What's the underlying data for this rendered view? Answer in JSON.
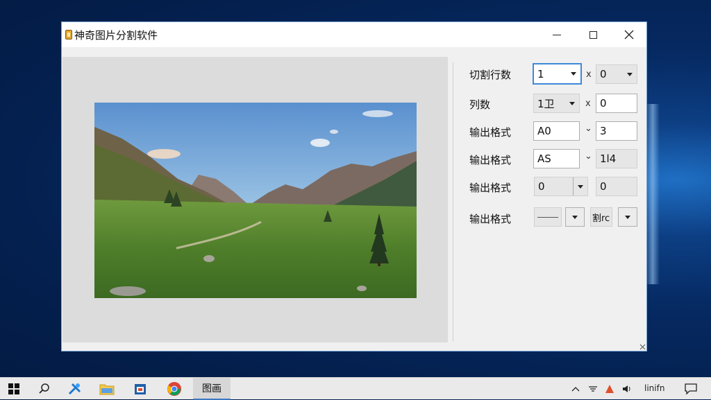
{
  "window": {
    "title": "神奇图片分割软件"
  },
  "form": {
    "rows_label": "切割行数",
    "rows_value": "1",
    "rows_sep": "x",
    "rows_value2": "0",
    "cols_label": "列数",
    "cols_value": "1卫",
    "cols_sep": "x",
    "cols_value2": "0",
    "format1_label": "输出格式",
    "format1_value": "A0",
    "format1_sep": "⌄",
    "format1_value2": "3",
    "format2_label": "输出格式",
    "format2_value": "AS",
    "format2_sep": "⌄",
    "format2_value2": "1l4",
    "format3_label": "输出格式",
    "format3_value": "0",
    "format3_value2": "0",
    "format4_label": "输出格式",
    "format4_value2": "割rc"
  },
  "taskbar": {
    "active_app": "图画",
    "tray_text": "linifn"
  },
  "colors": {
    "focus": "#3c8ad8",
    "taskbar_active": "#3b78c2"
  }
}
